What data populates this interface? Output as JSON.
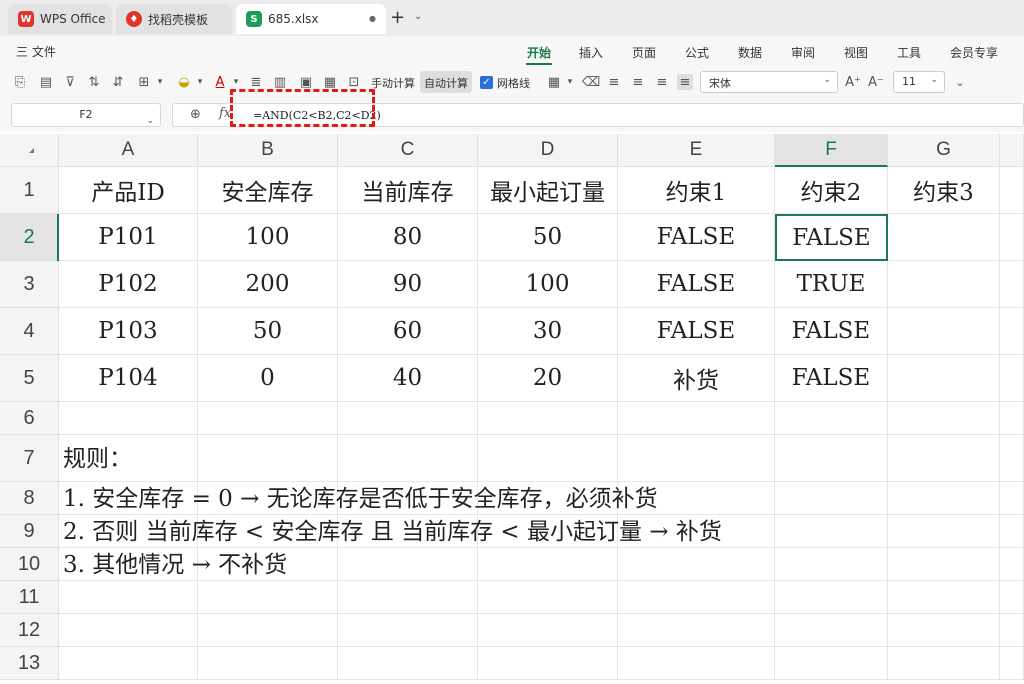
{
  "tabs": [
    {
      "label": "WPS Office",
      "icon": "wps-logo-icon"
    },
    {
      "label": "找稻壳模板",
      "icon": "docer-logo-icon"
    },
    {
      "label": "685.xlsx",
      "icon": "sheet-logo-icon",
      "logo_letter": "S",
      "close": "●"
    }
  ],
  "tab_new": "+",
  "menu": {
    "file": "三 文件",
    "items": [
      "开始",
      "插入",
      "页面",
      "公式",
      "数据",
      "审阅",
      "视图",
      "工具",
      "会员专享"
    ],
    "active": "开始"
  },
  "toolbar": {
    "manual_calc": "手动计算",
    "auto_calc": "自动计算",
    "gridlines": "网格线",
    "font": "宋体",
    "font_size": "11",
    "grow_font": "A⁺",
    "shrink_font": "A⁻"
  },
  "formula_bar": {
    "cell_ref": "F2",
    "fx": "fx",
    "formula": "=AND(C2<B2,C2<D2)"
  },
  "grid": {
    "columns": [
      "A",
      "B",
      "C",
      "D",
      "E",
      "F",
      "G"
    ],
    "rows": [
      "1",
      "2",
      "3",
      "4",
      "5",
      "6",
      "7",
      "8",
      "9",
      "10",
      "11",
      "12",
      "13"
    ],
    "selected_column": "F",
    "selected_row": "2",
    "headers": [
      "产品ID",
      "安全库存",
      "当前库存",
      "最小起订量",
      "约束1",
      "约束2",
      "约束3"
    ],
    "data": [
      [
        "P101",
        "100",
        "80",
        "50",
        "FALSE",
        "FALSE",
        ""
      ],
      [
        "P102",
        "200",
        "90",
        "100",
        "FALSE",
        "TRUE",
        ""
      ],
      [
        "P103",
        "50",
        "60",
        "30",
        "FALSE",
        "FALSE",
        ""
      ],
      [
        "P104",
        "0",
        "40",
        "20",
        "补货",
        "FALSE",
        ""
      ]
    ],
    "notes": [
      "规则：",
      "1. 安全库存 = 0 → 无论库存是否低于安全库存，必须补货",
      "2. 否则 当前库存 < 安全库存 且 当前库存 < 最小起订量 → 补货",
      "3. 其他情况 → 不补货"
    ]
  },
  "colors": {
    "accent": "#1b7a4a",
    "highlight": "#e8180c",
    "wps_red": "#e0352b",
    "sheet_green": "#1d9b5a"
  }
}
